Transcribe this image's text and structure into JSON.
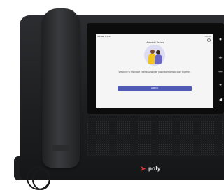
{
  "device": {
    "brand": "poly",
    "brand_color": "#e5383b"
  },
  "screen": {
    "status_left": "Sat Jan 1 2023",
    "status_right": "1:00 PM",
    "app_title": "Microsoft Teams",
    "welcome_text": "Welcome to Microsoft Teams! A happier place for teams to work together.",
    "signin_label": "Sign in",
    "accent_color": "#5058b8"
  },
  "side_keys": {
    "contacts_icon": "contacts-icon",
    "volume_up_icon": "volume-up-icon",
    "volume_down_icon": "volume-down-icon",
    "headset_icon": "headset-icon",
    "speaker_icon": "speaker-icon"
  }
}
